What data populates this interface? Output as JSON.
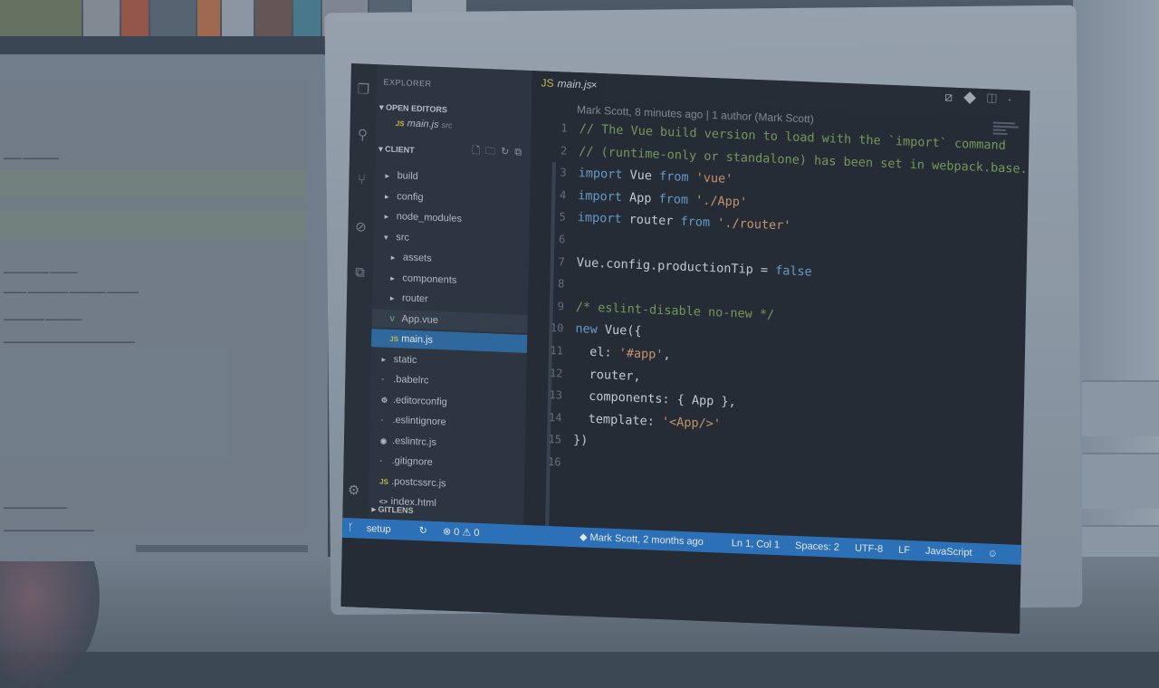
{
  "explorer": {
    "title": "EXPLORER",
    "open_editors_header": "OPEN EDITORS",
    "open_editor": {
      "name": "main.js",
      "dir": "src"
    },
    "client_header": "CLIENT",
    "gitlens_header": "GITLENS",
    "tree": [
      {
        "name": "build",
        "type": "folder",
        "depth": 1
      },
      {
        "name": "config",
        "type": "folder",
        "depth": 1
      },
      {
        "name": "node_modules",
        "type": "folder",
        "depth": 1
      },
      {
        "name": "src",
        "type": "folder-open",
        "depth": 1
      },
      {
        "name": "assets",
        "type": "folder",
        "depth": 2
      },
      {
        "name": "components",
        "type": "folder",
        "depth": 2
      },
      {
        "name": "router",
        "type": "folder",
        "depth": 2
      },
      {
        "name": "App.vue",
        "type": "vue",
        "depth": 2
      },
      {
        "name": "main.js",
        "type": "js",
        "depth": 2
      },
      {
        "name": "static",
        "type": "folder",
        "depth": 1
      },
      {
        "name": ".babelrc",
        "type": "file",
        "depth": 1
      },
      {
        "name": ".editorconfig",
        "type": "gear",
        "depth": 1
      },
      {
        "name": ".eslintignore",
        "type": "file",
        "depth": 1
      },
      {
        "name": ".eslintrc.js",
        "type": "eslint",
        "depth": 1
      },
      {
        "name": ".gitignore",
        "type": "file",
        "depth": 1
      },
      {
        "name": ".postcssrc.js",
        "type": "js",
        "depth": 1
      },
      {
        "name": "index.html",
        "type": "html",
        "depth": 1
      }
    ]
  },
  "editor": {
    "tab": "main.js",
    "tab_icon": "JS",
    "blame": "Mark Scott, 8 minutes ago | 1 author (Mark Scott)",
    "lines": [
      "// The Vue build version to load with the `import` command",
      "// (runtime-only or standalone) has been set in webpack.base.",
      "import Vue from 'vue'",
      "import App from './App'",
      "import router from './router'",
      "",
      "Vue.config.productionTip = false",
      "",
      "/* eslint-disable no-new */",
      "new Vue({",
      "  el: '#app',",
      "  router,",
      "  components: { App },",
      "  template: '<App/>'",
      "})",
      ""
    ]
  },
  "status": {
    "branch": "setup",
    "problems": "⊗ 0 ⚠ 0",
    "git_blame": "Mark Scott, 2 months ago",
    "cursor": "Ln 1, Col 1",
    "spaces": "Spaces: 2",
    "encoding": "UTF-8",
    "eol": "LF",
    "language": "JavaScript"
  },
  "colors": {
    "status_bar": "#2d78c5",
    "selection": "#2f6fa8",
    "comment": "#7fa45a",
    "keyword": "#6fa7d9",
    "string": "#d9a06f"
  }
}
